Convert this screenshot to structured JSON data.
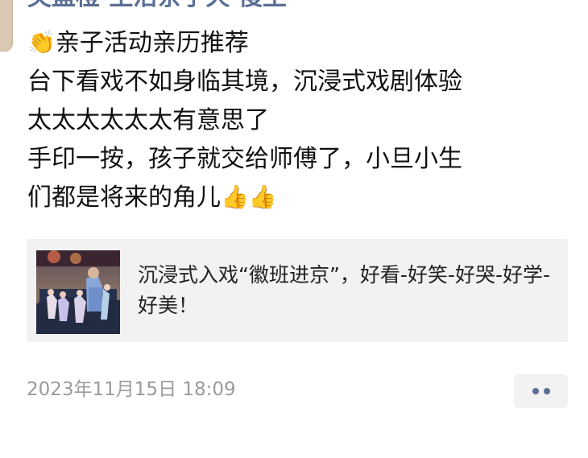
{
  "post": {
    "author": "芙蓝橙·生活亲子天 慢生",
    "lines": [
      "亲子活动亲历推荐",
      "台下看戏不如身临其境，沉浸式戏剧体验",
      "太太太太太太有意思了",
      "手印一按，孩子就交给师傅了，小旦小生",
      "们都是将来的角儿"
    ],
    "leading_emoji": "👏",
    "trailing_emoji": "👍👍",
    "link_card": {
      "title": "沉浸式入戏“徽班进京”，好看-好笑-好哭-好学-好美！",
      "thumbnail_icon": "stage-performance-thumbnail-icon"
    },
    "timestamp": "2023年11月15日 18:09",
    "more_icon": "more-options-icon"
  }
}
